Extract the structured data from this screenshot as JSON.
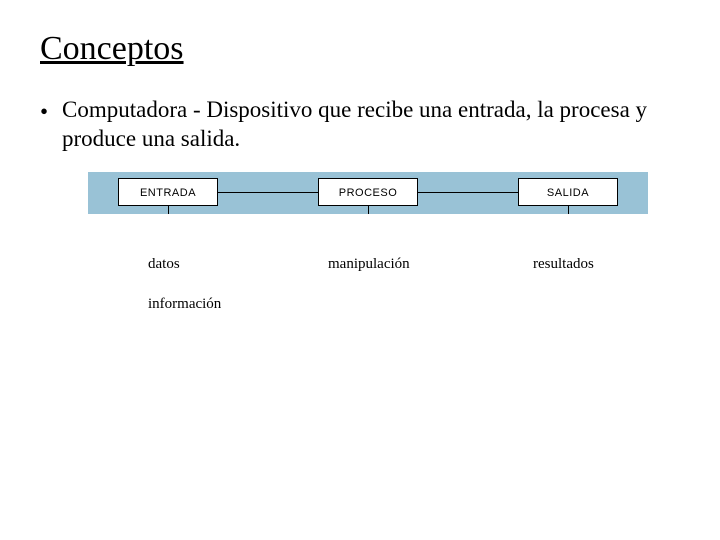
{
  "title": "Conceptos",
  "bullet": {
    "dot": "•",
    "text": "Computadora - Dispositivo que recibe una entrada, la procesa y produce una salida."
  },
  "diagram": {
    "entrada": "ENTRADA",
    "proceso": "PROCESO",
    "salida": "SALIDA"
  },
  "labels": {
    "datos": "datos",
    "manipulacion": "manipulación",
    "resultados": "resultados",
    "informacion": "información"
  }
}
